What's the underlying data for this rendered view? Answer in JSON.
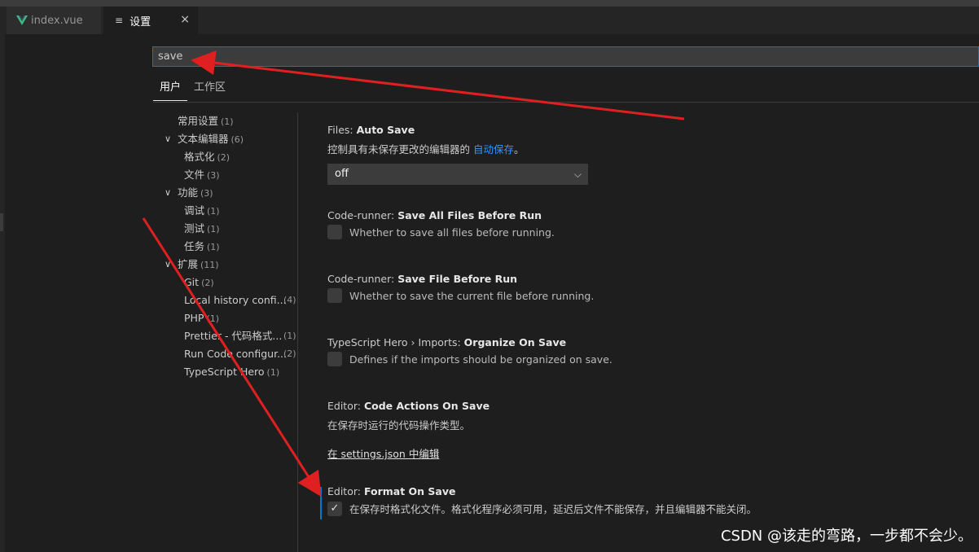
{
  "tabs": {
    "index": "index.vue",
    "settings": "设置",
    "close": "×"
  },
  "search": {
    "value": "save"
  },
  "scope": {
    "user": "用户",
    "workspace": "工作区"
  },
  "toc": [
    {
      "label": "常用设置",
      "count": "(1)"
    },
    {
      "label": "文本编辑器",
      "count": "(6)"
    },
    {
      "label": "格式化",
      "count": "(2)"
    },
    {
      "label": "文件",
      "count": "(3)"
    },
    {
      "label": "功能",
      "count": "(3)"
    },
    {
      "label": "调试",
      "count": "(1)"
    },
    {
      "label": "测试",
      "count": "(1)"
    },
    {
      "label": "任务",
      "count": "(1)"
    },
    {
      "label": "扩展",
      "count": "(11)"
    },
    {
      "label": "Git",
      "count": "(2)"
    },
    {
      "label": "Local history confi...",
      "count": "(4)"
    },
    {
      "label": "PHP",
      "count": "(1)"
    },
    {
      "label": "Prettier - 代码格式...",
      "count": "(1)"
    },
    {
      "label": "Run Code configur...",
      "count": "(2)"
    },
    {
      "label": "TypeScript Hero",
      "count": "(1)"
    }
  ],
  "settings": {
    "auto_save": {
      "prefix": "Files: ",
      "name": "Auto Save",
      "desc_pre": "控制具有未保存更改的编辑器的 ",
      "desc_link": "自动保存",
      "desc_post": "。",
      "value": "off"
    },
    "save_all": {
      "prefix": "Code-runner: ",
      "name": "Save All Files Before Run",
      "desc": "Whether to save all files before running."
    },
    "save_file": {
      "prefix": "Code-runner: ",
      "name": "Save File Before Run",
      "desc": "Whether to save the current file before running."
    },
    "organize": {
      "prefix": "TypeScript Hero › Imports: ",
      "name": "Organize On Save",
      "desc": "Defines if the imports should be organized on save."
    },
    "code_actions": {
      "prefix": "Editor: ",
      "name": "Code Actions On Save",
      "desc": "在保存时运行的代码操作类型。",
      "link": "在 settings.json 中编辑"
    },
    "format_on_save": {
      "prefix": "Editor: ",
      "name": "Format On Save",
      "desc": "在保存时格式化文件。格式化程序必须可用，延迟后文件不能保存，并且编辑器不能关闭。",
      "checked": true
    }
  },
  "watermark": "CSDN @该走的弯路，一步都不会少。",
  "colors": {
    "accent": "#007acc",
    "arrow": "#e02020",
    "link": "#3794ff"
  }
}
